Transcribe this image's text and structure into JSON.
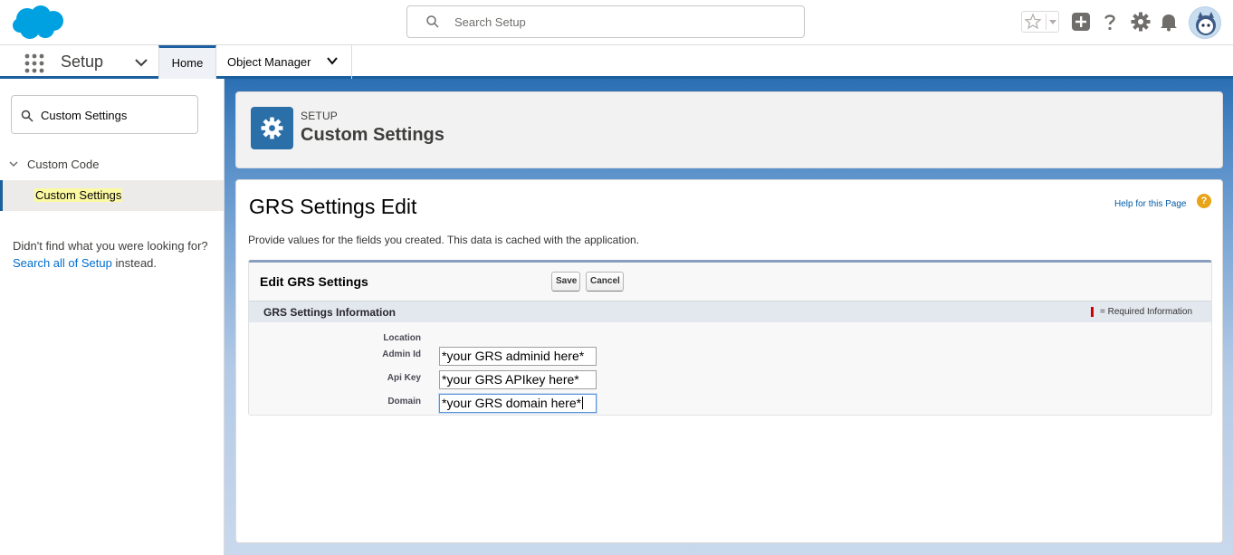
{
  "header": {
    "search_placeholder": "Search Setup"
  },
  "context_bar": {
    "app_name": "Setup",
    "tabs": [
      {
        "label": "Home"
      },
      {
        "label": "Object Manager"
      }
    ]
  },
  "sidebar": {
    "quick_find_value": "Custom Settings",
    "tree_parent": "Custom Code",
    "tree_child": "Custom Settings",
    "not_found_prefix": "Didn't find what you were looking for?",
    "not_found_link": "Search all of Setup",
    "not_found_suffix": "instead."
  },
  "setup_header": {
    "label": "SETUP",
    "title": "Custom Settings"
  },
  "page": {
    "title": "GRS Settings Edit",
    "help_link": "Help for this Page",
    "description": "Provide values for the fields you created. This data is cached with the application."
  },
  "edit_block": {
    "title": "Edit GRS Settings",
    "save_label": "Save",
    "cancel_label": "Cancel",
    "section_title": "GRS Settings Information",
    "required_text": "= Required Information",
    "fields": [
      {
        "label": "Location",
        "value": ""
      },
      {
        "label": "Admin Id",
        "value": "*your GRS adminid here*"
      },
      {
        "label": "Api Key",
        "value": "*your GRS APIkey here*"
      },
      {
        "label": "Domain",
        "value": "*your GRS domain here*"
      }
    ]
  },
  "colors": {
    "brand_blue": "#1b5f9e",
    "link_blue": "#006dcc",
    "setup_icon_bg": "#2b6fa8",
    "required_red": "#cc0000",
    "help_orange": "#e8a317"
  },
  "icons": [
    "salesforce-cloud-icon",
    "search-icon",
    "star-icon",
    "add-icon",
    "help-icon",
    "gear-icon",
    "bell-icon",
    "app-launcher-icon",
    "chevron-down-icon"
  ]
}
